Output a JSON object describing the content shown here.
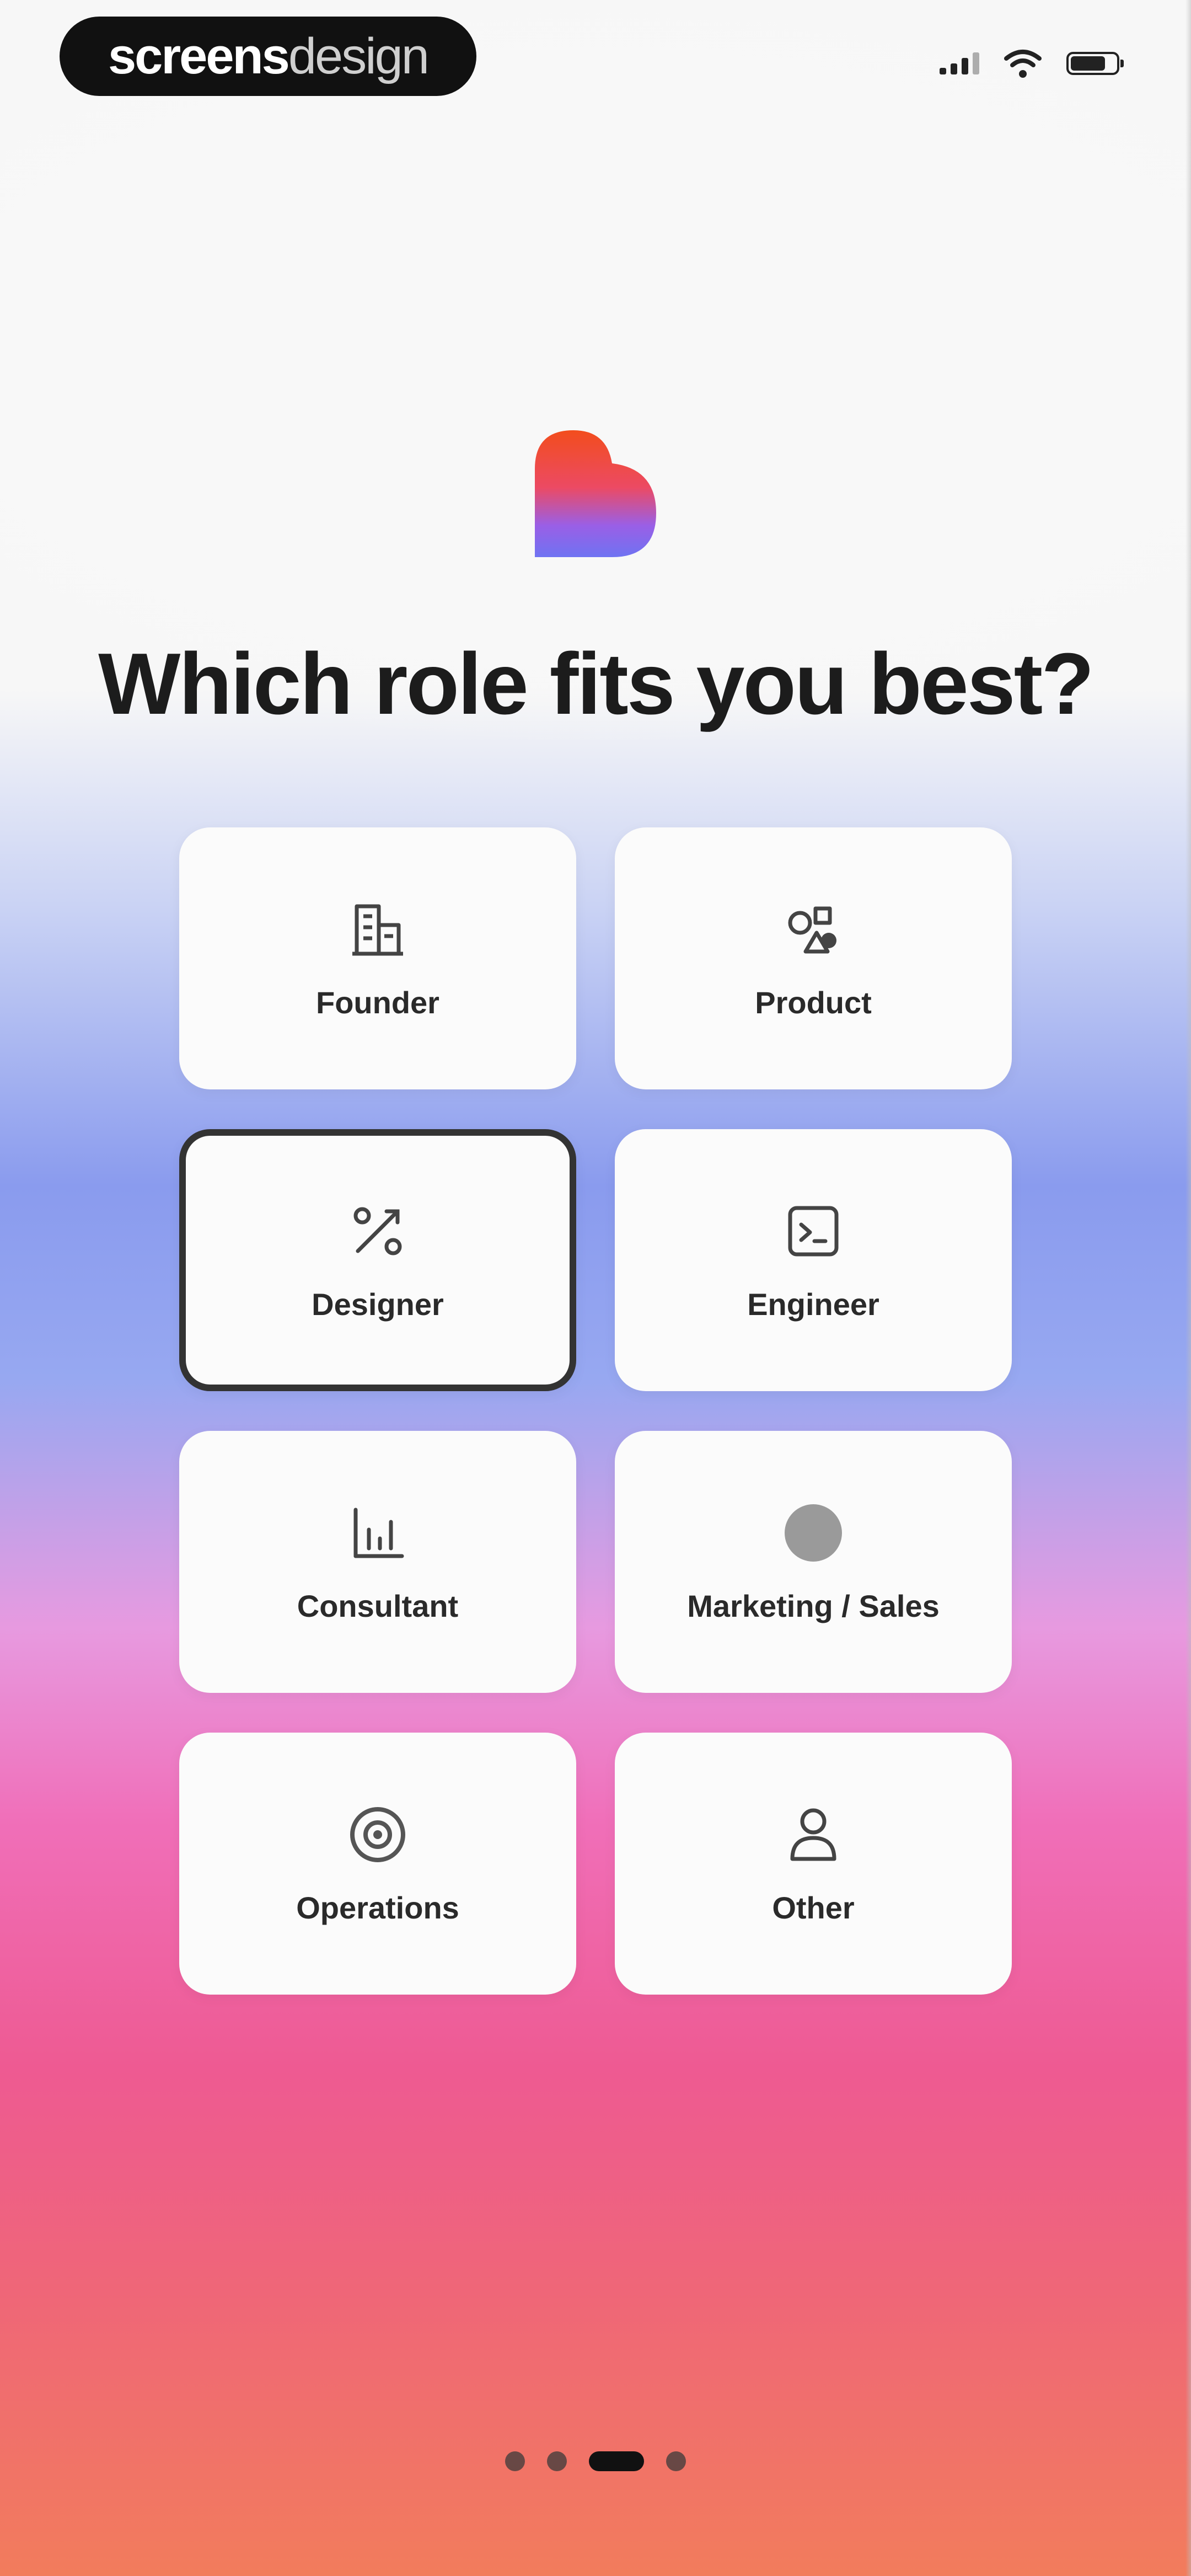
{
  "brand": {
    "bold": "screens",
    "light": "design"
  },
  "status_bar": {
    "signal_icon": "cellular-signal-icon",
    "wifi_icon": "wifi-icon",
    "battery_icon": "battery-icon"
  },
  "logo": {
    "icon": "heart-logo-icon",
    "colors": [
      "#f24d1d",
      "#e8457d",
      "#7a6cf2"
    ]
  },
  "title": "Which role fits you best?",
  "roles": [
    {
      "label": "Founder",
      "icon": "building-icon",
      "selected": false
    },
    {
      "label": "Product",
      "icon": "shapes-icon",
      "selected": false
    },
    {
      "label": "Designer",
      "icon": "pen-tool-icon",
      "selected": true
    },
    {
      "label": "Engineer",
      "icon": "terminal-icon",
      "selected": false
    },
    {
      "label": "Consultant",
      "icon": "bar-chart-icon",
      "selected": false
    },
    {
      "label": "Marketing / Sales",
      "icon": "circle-icon",
      "selected": false
    },
    {
      "label": "Operations",
      "icon": "target-icon",
      "selected": false
    },
    {
      "label": "Other",
      "icon": "person-icon",
      "selected": false
    }
  ],
  "pagination": {
    "total": 4,
    "active": 3
  }
}
